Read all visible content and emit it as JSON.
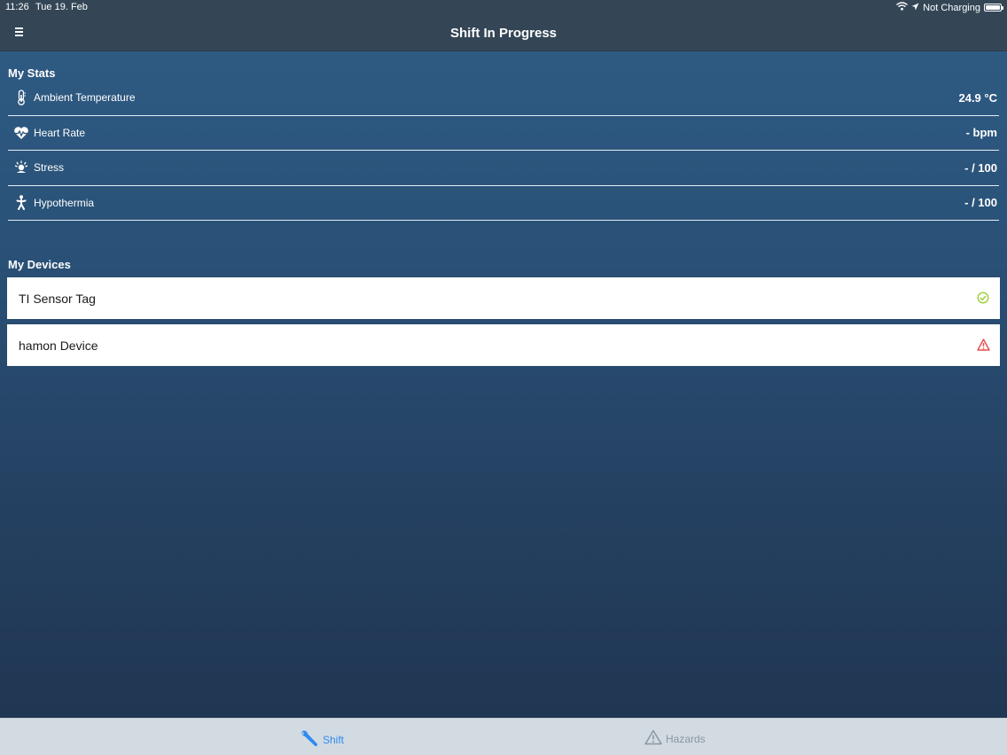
{
  "status_bar": {
    "time": "11:26",
    "date": "Tue 19. Feb",
    "charging": "Not Charging"
  },
  "header": {
    "title": "Shift In Progress"
  },
  "stats": {
    "title": "My Stats",
    "items": [
      {
        "label": "Ambient Temperature",
        "value": "24.9 °C",
        "icon": "thermometer-icon"
      },
      {
        "label": "Heart Rate",
        "value": "- bpm",
        "icon": "heart-rate-icon"
      },
      {
        "label": "Stress",
        "value": "- / 100",
        "icon": "stress-icon"
      },
      {
        "label": "Hypothermia",
        "value": "- / 100",
        "icon": "person-icon"
      }
    ]
  },
  "devices": {
    "title": "My Devices",
    "items": [
      {
        "name": "TI Sensor Tag",
        "status": "connected",
        "icon": "check-circle-icon"
      },
      {
        "name": "hamon Device",
        "status": "warning",
        "icon": "warning-triangle-icon"
      }
    ]
  },
  "tabs": [
    {
      "label": "Shift",
      "icon": "wrench-icon",
      "active": true
    },
    {
      "label": "Hazards",
      "icon": "hazard-triangle-icon",
      "active": false
    }
  ],
  "colors": {
    "accent": "#2e8cf0",
    "ok": "#9bcf3a",
    "warning": "#e74c4c",
    "bar": "#344656"
  }
}
